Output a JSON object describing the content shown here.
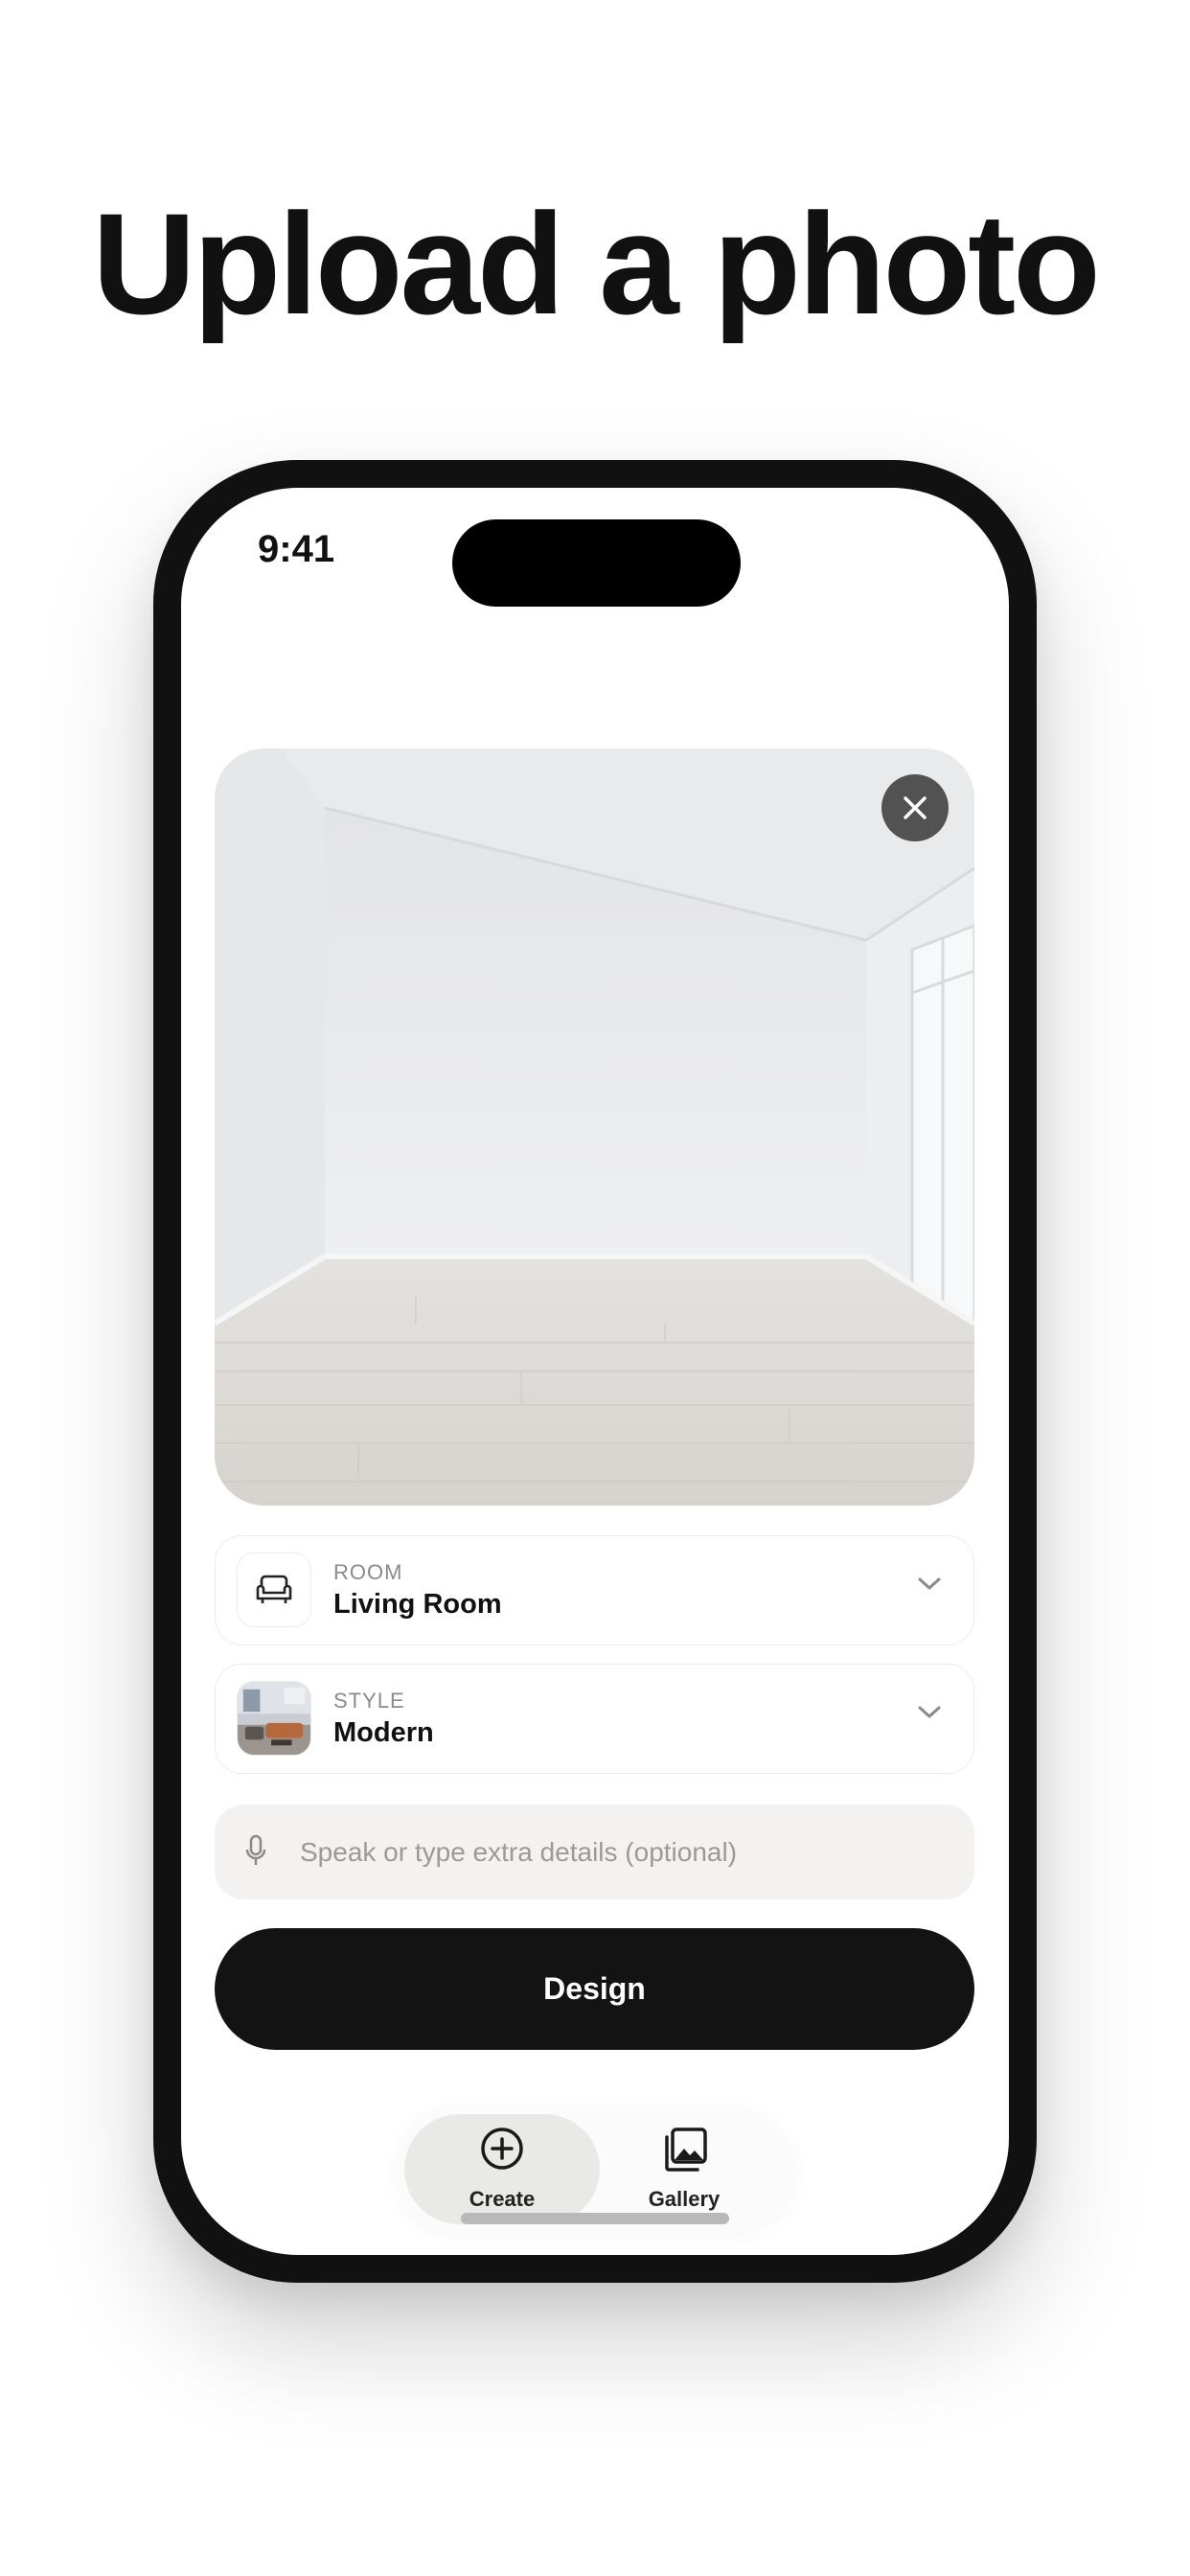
{
  "headline": "Upload a photo",
  "status_bar": {
    "time": "9:41"
  },
  "photo": {
    "description_icon": "empty-room-photo",
    "close_icon": "close-icon"
  },
  "room_select": {
    "kicker": "ROOM",
    "value": "Living Room",
    "icon": "sofa-icon"
  },
  "style_select": {
    "kicker": "STYLE",
    "value": "Modern",
    "icon": "style-thumbnail"
  },
  "prompt": {
    "placeholder": "Speak or type extra details (optional)",
    "icon": "microphone-icon"
  },
  "design_button": {
    "label": "Design"
  },
  "tabbar": {
    "tabs": [
      {
        "label": "Create",
        "icon": "plus-circle-icon",
        "active": true
      },
      {
        "label": "Gallery",
        "icon": "gallery-icon",
        "active": false
      }
    ]
  },
  "colors": {
    "primary": "#131313",
    "background": "#ffffff",
    "input_bg": "#f3f2f1",
    "muted_text": "#8a8a8a"
  }
}
